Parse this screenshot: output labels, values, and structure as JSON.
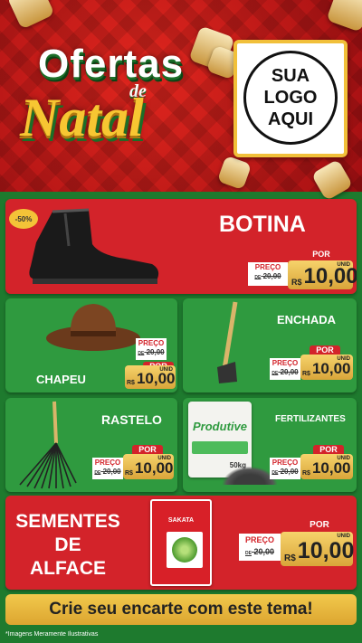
{
  "header": {
    "title_line1": "Ofertas",
    "title_line2": "de",
    "title_line3": "Natal",
    "logo_placeholder": [
      "SUA",
      "LOGO",
      "AQUI"
    ]
  },
  "products": [
    {
      "name": "BOTINA",
      "badge": "-50%",
      "preco_label": "PREÇO",
      "old_price": "20,00",
      "por_label": "POR",
      "currency": "R$",
      "price": "10,00",
      "unit": "UNID"
    },
    {
      "name": "CHAPEU",
      "preco_label": "PREÇO",
      "old_price": "20,00",
      "por_label": "POR",
      "currency": "R$",
      "price": "10,00",
      "unit": "UNID"
    },
    {
      "name": "ENCHADA",
      "preco_label": "PREÇO",
      "old_price": "20,00",
      "por_label": "POR",
      "currency": "R$",
      "price": "10,00",
      "unit": "UNID"
    },
    {
      "name": "RASTELO",
      "preco_label": "PREÇO",
      "old_price": "20,00",
      "por_label": "POR",
      "currency": "R$",
      "price": "10,00",
      "unit": "UNID"
    },
    {
      "name": "FERTILIZANTES",
      "product_label": "Produtive",
      "weight": "50kg",
      "preco_label": "PREÇO",
      "old_price": "20,00",
      "por_label": "POR",
      "currency": "R$",
      "price": "10,00",
      "unit": "UNID"
    },
    {
      "name_lines": [
        "SEMENTES",
        "DE",
        "ALFACE"
      ],
      "brand": "SAKATA",
      "preco_label": "PREÇO",
      "old_price": "20,00",
      "por_label": "POR",
      "currency": "R$",
      "price": "10,00",
      "unit": "UNID"
    }
  ],
  "de_label": "DE",
  "cta": "Crie seu encarte com este tema!",
  "footer_note": "*Imagens Meramente Ilustrativas",
  "colors": {
    "red": "#d3232a",
    "green": "#2f9a3f",
    "gold": "#f1c03a"
  }
}
